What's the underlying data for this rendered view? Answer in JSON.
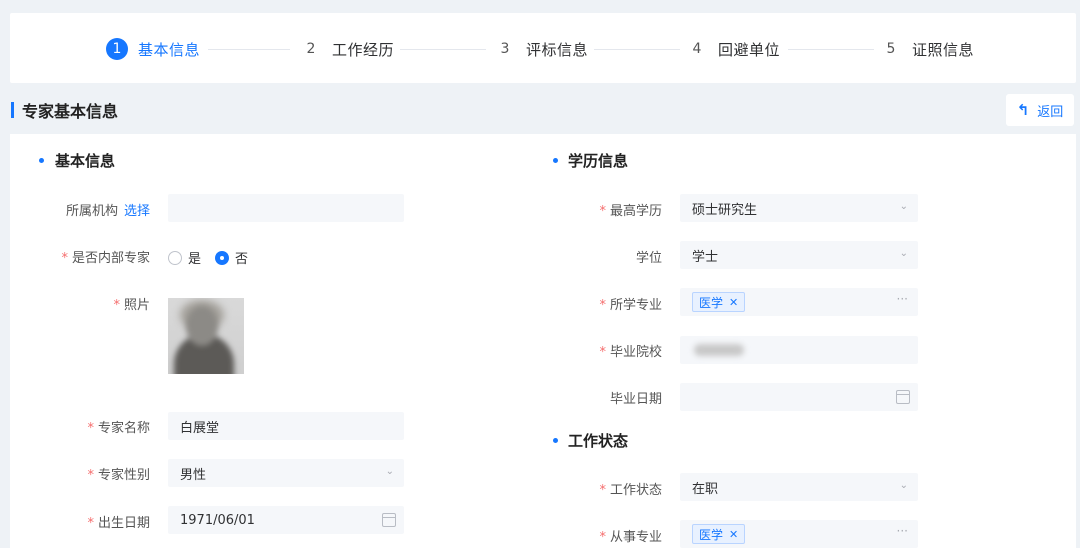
{
  "steps": [
    {
      "num": "1",
      "label": "基本信息"
    },
    {
      "num": "2",
      "label": "工作经历"
    },
    {
      "num": "3",
      "label": "评标信息"
    },
    {
      "num": "4",
      "label": "回避单位"
    },
    {
      "num": "5",
      "label": "证照信息"
    }
  ],
  "header": {
    "title": "专家基本信息",
    "back_label": "返回",
    "back_icon": "undo-arrow-icon"
  },
  "colors": {
    "accent": "#1677ff",
    "required": "#f56c6c"
  },
  "basic": {
    "title": "基本信息",
    "org_label": "所属机构",
    "org_link": "选择",
    "org_value": "",
    "internal_label": "是否内部专家",
    "internal_yes": "是",
    "internal_no": "否",
    "internal_selected": "否",
    "photo_label": "照片",
    "name_label": "专家名称",
    "name_value": "白展堂",
    "gender_label": "专家性别",
    "gender_value": "男性",
    "birth_label": "出生日期",
    "birth_value": "1971/06/01"
  },
  "education": {
    "title": "学历信息",
    "degree_label": "最高学历",
    "degree_value": "硕士研究生",
    "academic_label": "学位",
    "academic_value": "学士",
    "major_label": "所学专业",
    "major_tag": "医学",
    "school_label": "毕业院校",
    "grad_label": "毕业日期",
    "grad_value": ""
  },
  "work": {
    "title": "工作状态",
    "status_label": "工作状态",
    "status_value": "在职",
    "field_label": "从事专业",
    "field_tag": "医学"
  },
  "icons": {
    "select": "chevron-down-icon",
    "calendar": "calendar-icon",
    "more": "ellipsis-icon",
    "tag_close": "close-icon"
  }
}
